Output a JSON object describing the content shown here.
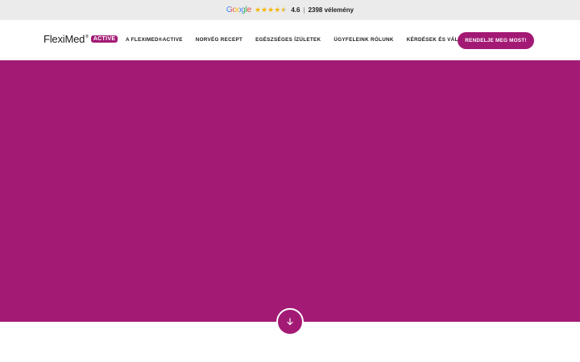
{
  "rating_bar": {
    "brand": "Google",
    "score": "4.6",
    "star_rating": 4.6,
    "separator": "|",
    "reviews": "2398 vélemény"
  },
  "header": {
    "logo_text": "FlexiMed",
    "logo_reg": "®",
    "logo_badge": "ACTIVE",
    "nav": [
      {
        "label": "A FLEXIMED®ACTIVE"
      },
      {
        "label": "NORVÉG RECEPT"
      },
      {
        "label": "EGÉSZSÉGES ÍZÜLETEK"
      },
      {
        "label": "ÜGYFELEINK RÓLUNK"
      },
      {
        "label": "KÉRDÉSEK ÉS VÁLASZOK"
      }
    ],
    "cta_label": "RENDELJE MEG MOST!"
  },
  "hero": {
    "scroll_icon": "arrow-down-icon"
  },
  "colors": {
    "brand": "#a31a75",
    "topbar_bg": "#ebebeb",
    "star": "#f5b400"
  }
}
